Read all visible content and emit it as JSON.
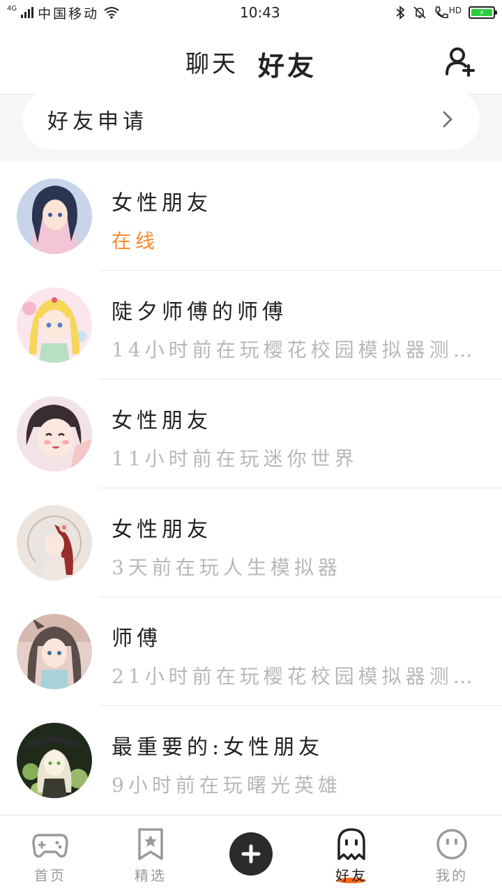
{
  "status_bar": {
    "network_type": "4G",
    "carrier": "中国移动",
    "time": "10:43",
    "hd_label": "HD",
    "battery_icon": "battery-charging-icon"
  },
  "header": {
    "tabs": [
      {
        "label": "聊天",
        "active": false
      },
      {
        "label": "好友",
        "active": true
      }
    ],
    "accent_color": "#ff5a1f",
    "add_friend_icon": "add-user-icon"
  },
  "friend_request": {
    "label": "好友申请"
  },
  "friends": [
    {
      "name": "女性朋友",
      "status": "在线",
      "online": true
    },
    {
      "name": "陡夕师傅的师傅",
      "status": "14小时前在玩樱花校园模拟器测…",
      "online": false
    },
    {
      "name": "女性朋友",
      "status": "11小时前在玩迷你世界",
      "online": false
    },
    {
      "name": "女性朋友",
      "status": "3天前在玩人生模拟器",
      "online": false
    },
    {
      "name": "师傅",
      "status": "21小时前在玩樱花校园模拟器测…",
      "online": false
    },
    {
      "name": "最重要的:女性朋友",
      "status": "9小时前在玩曙光英雄",
      "online": false
    }
  ],
  "bottom_nav": {
    "items": [
      {
        "label": "首页",
        "icon": "gamepad-icon"
      },
      {
        "label": "精选",
        "icon": "star-bookmark-icon"
      },
      {
        "label": "",
        "icon": "plus-icon"
      },
      {
        "label": "好友",
        "icon": "ghost-icon",
        "active": true
      },
      {
        "label": "我的",
        "icon": "face-icon"
      }
    ]
  }
}
